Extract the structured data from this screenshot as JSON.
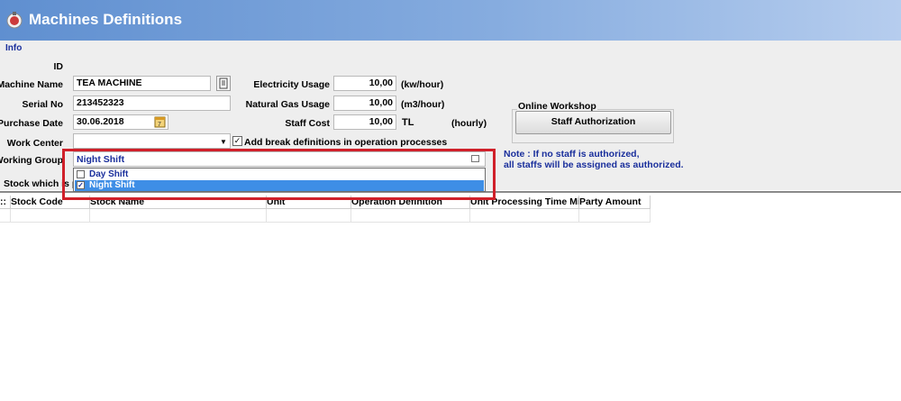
{
  "window": {
    "title": "Machines Definitions",
    "icon": "machine-tag-icon"
  },
  "section": {
    "info_label": "Info"
  },
  "labels": {
    "id": "ID",
    "machine_name": "Machine Name",
    "serial_no": "Serial No",
    "purchase_date": "Purchase Date",
    "work_center": "Work Center",
    "working_group": "Working Group",
    "electricity_usage": "Electricity Usage",
    "natural_gas_usage": "Natural Gas Usage",
    "staff_cost": "Staff Cost"
  },
  "fields": {
    "id": "",
    "machine_name": "TEA MACHINE",
    "serial_no": "213452323",
    "purchase_date": "30.06.2018",
    "work_center": "",
    "electricity_usage": "10,00",
    "natural_gas_usage": "10,00",
    "staff_cost": "10,00"
  },
  "units": {
    "electricity": "(kw/hour)",
    "natural_gas": "(m3/hour)",
    "staff_cost_currency": "TL",
    "staff_cost_period": "(hourly)"
  },
  "checkbox_break": {
    "label": "Add break definitions in operation processes",
    "checked": true
  },
  "online_workshop": {
    "title": "Online Workshop",
    "button": "Staff Authorization",
    "note_line1": "Note : If no staff is authorized,",
    "note_line2": "all staffs will be assigned as authorized."
  },
  "working_group_dropdown": {
    "selected": "Night Shift",
    "options": [
      {
        "label": "Day Shift",
        "checked": false,
        "highlighted": false
      },
      {
        "label": "Night Shift",
        "checked": true,
        "highlighted": true
      }
    ]
  },
  "stock_tab": {
    "label_visible": "Stock which is pr"
  },
  "grid": {
    "columns": [
      "Stock Code",
      "Stock Name",
      "Unit",
      "Operation Definition",
      "Unit Processing Time Mi",
      "Party Amount"
    ]
  },
  "colors": {
    "highlight": "#3e8ee6",
    "accent": "#1a2f9c",
    "red_box": "#d0202a"
  }
}
